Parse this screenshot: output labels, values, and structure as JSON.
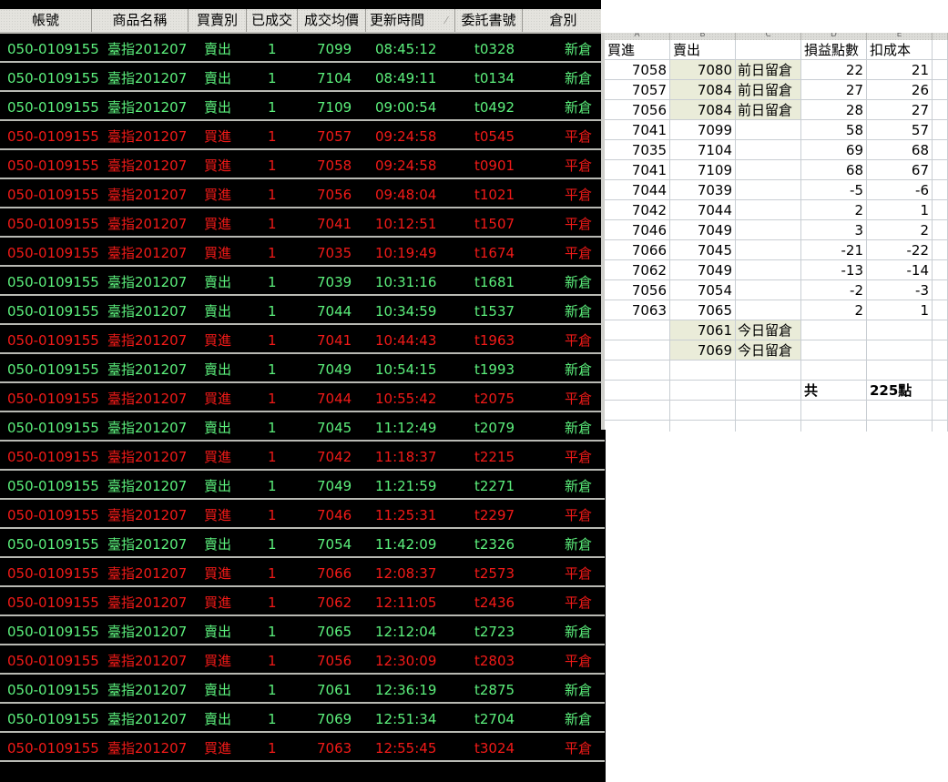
{
  "trade_table": {
    "columns": [
      "帳號",
      "商品名稱",
      "買賣別",
      "已成交",
      "成交均價",
      "更新時間",
      "委託書號",
      "倉別"
    ],
    "sorted_column_index": 5,
    "colors": {
      "sell_new": "#5cf07c",
      "buy_close": "#f21a18",
      "background": "#000000"
    },
    "rows": [
      {
        "account": "050-0109155",
        "product": "臺指201207",
        "side": "賣出",
        "filled": "1",
        "avg_price": "7099",
        "time": "08:45:12",
        "order_no": "t0328",
        "position": "新倉",
        "tone": "green"
      },
      {
        "account": "050-0109155",
        "product": "臺指201207",
        "side": "賣出",
        "filled": "1",
        "avg_price": "7104",
        "time": "08:49:11",
        "order_no": "t0134",
        "position": "新倉",
        "tone": "green"
      },
      {
        "account": "050-0109155",
        "product": "臺指201207",
        "side": "賣出",
        "filled": "1",
        "avg_price": "7109",
        "time": "09:00:54",
        "order_no": "t0492",
        "position": "新倉",
        "tone": "green"
      },
      {
        "account": "050-0109155",
        "product": "臺指201207",
        "side": "買進",
        "filled": "1",
        "avg_price": "7057",
        "time": "09:24:58",
        "order_no": "t0545",
        "position": "平倉",
        "tone": "red"
      },
      {
        "account": "050-0109155",
        "product": "臺指201207",
        "side": "買進",
        "filled": "1",
        "avg_price": "7058",
        "time": "09:24:58",
        "order_no": "t0901",
        "position": "平倉",
        "tone": "red"
      },
      {
        "account": "050-0109155",
        "product": "臺指201207",
        "side": "買進",
        "filled": "1",
        "avg_price": "7056",
        "time": "09:48:04",
        "order_no": "t1021",
        "position": "平倉",
        "tone": "red"
      },
      {
        "account": "050-0109155",
        "product": "臺指201207",
        "side": "買進",
        "filled": "1",
        "avg_price": "7041",
        "time": "10:12:51",
        "order_no": "t1507",
        "position": "平倉",
        "tone": "red"
      },
      {
        "account": "050-0109155",
        "product": "臺指201207",
        "side": "買進",
        "filled": "1",
        "avg_price": "7035",
        "time": "10:19:49",
        "order_no": "t1674",
        "position": "平倉",
        "tone": "red"
      },
      {
        "account": "050-0109155",
        "product": "臺指201207",
        "side": "賣出",
        "filled": "1",
        "avg_price": "7039",
        "time": "10:31:16",
        "order_no": "t1681",
        "position": "新倉",
        "tone": "green"
      },
      {
        "account": "050-0109155",
        "product": "臺指201207",
        "side": "賣出",
        "filled": "1",
        "avg_price": "7044",
        "time": "10:34:59",
        "order_no": "t1537",
        "position": "新倉",
        "tone": "green"
      },
      {
        "account": "050-0109155",
        "product": "臺指201207",
        "side": "買進",
        "filled": "1",
        "avg_price": "7041",
        "time": "10:44:43",
        "order_no": "t1963",
        "position": "平倉",
        "tone": "red"
      },
      {
        "account": "050-0109155",
        "product": "臺指201207",
        "side": "賣出",
        "filled": "1",
        "avg_price": "7049",
        "time": "10:54:15",
        "order_no": "t1993",
        "position": "新倉",
        "tone": "green"
      },
      {
        "account": "050-0109155",
        "product": "臺指201207",
        "side": "買進",
        "filled": "1",
        "avg_price": "7044",
        "time": "10:55:42",
        "order_no": "t2075",
        "position": "平倉",
        "tone": "red"
      },
      {
        "account": "050-0109155",
        "product": "臺指201207",
        "side": "賣出",
        "filled": "1",
        "avg_price": "7045",
        "time": "11:12:49",
        "order_no": "t2079",
        "position": "新倉",
        "tone": "green"
      },
      {
        "account": "050-0109155",
        "product": "臺指201207",
        "side": "買進",
        "filled": "1",
        "avg_price": "7042",
        "time": "11:18:37",
        "order_no": "t2215",
        "position": "平倉",
        "tone": "red"
      },
      {
        "account": "050-0109155",
        "product": "臺指201207",
        "side": "賣出",
        "filled": "1",
        "avg_price": "7049",
        "time": "11:21:59",
        "order_no": "t2271",
        "position": "新倉",
        "tone": "green"
      },
      {
        "account": "050-0109155",
        "product": "臺指201207",
        "side": "買進",
        "filled": "1",
        "avg_price": "7046",
        "time": "11:25:31",
        "order_no": "t2297",
        "position": "平倉",
        "tone": "red"
      },
      {
        "account": "050-0109155",
        "product": "臺指201207",
        "side": "賣出",
        "filled": "1",
        "avg_price": "7054",
        "time": "11:42:09",
        "order_no": "t2326",
        "position": "新倉",
        "tone": "green"
      },
      {
        "account": "050-0109155",
        "product": "臺指201207",
        "side": "買進",
        "filled": "1",
        "avg_price": "7066",
        "time": "12:08:37",
        "order_no": "t2573",
        "position": "平倉",
        "tone": "red"
      },
      {
        "account": "050-0109155",
        "product": "臺指201207",
        "side": "買進",
        "filled": "1",
        "avg_price": "7062",
        "time": "12:11:05",
        "order_no": "t2436",
        "position": "平倉",
        "tone": "red"
      },
      {
        "account": "050-0109155",
        "product": "臺指201207",
        "side": "賣出",
        "filled": "1",
        "avg_price": "7065",
        "time": "12:12:04",
        "order_no": "t2723",
        "position": "新倉",
        "tone": "green"
      },
      {
        "account": "050-0109155",
        "product": "臺指201207",
        "side": "買進",
        "filled": "1",
        "avg_price": "7056",
        "time": "12:30:09",
        "order_no": "t2803",
        "position": "平倉",
        "tone": "red"
      },
      {
        "account": "050-0109155",
        "product": "臺指201207",
        "side": "賣出",
        "filled": "1",
        "avg_price": "7061",
        "time": "12:36:19",
        "order_no": "t2875",
        "position": "新倉",
        "tone": "green"
      },
      {
        "account": "050-0109155",
        "product": "臺指201207",
        "side": "賣出",
        "filled": "1",
        "avg_price": "7069",
        "time": "12:51:34",
        "order_no": "t2704",
        "position": "新倉",
        "tone": "green"
      },
      {
        "account": "050-0109155",
        "product": "臺指201207",
        "side": "買進",
        "filled": "1",
        "avg_price": "7063",
        "time": "12:55:45",
        "order_no": "t3024",
        "position": "平倉",
        "tone": "red"
      }
    ]
  },
  "spreadsheet": {
    "column_letters": [
      "A",
      "B",
      "C",
      "D",
      "E",
      ""
    ],
    "header": {
      "buy": "買進",
      "sell": "賣出",
      "note": "",
      "pnl": "損益點數",
      "net": "扣成本"
    },
    "highlight_color": "#eef0df",
    "rows": [
      {
        "buy": "7058",
        "sell": "7080",
        "note": "前日留倉",
        "pnl": "22",
        "net": "21",
        "hl": true
      },
      {
        "buy": "7057",
        "sell": "7084",
        "note": "前日留倉",
        "pnl": "27",
        "net": "26",
        "hl": true
      },
      {
        "buy": "7056",
        "sell": "7084",
        "note": "前日留倉",
        "pnl": "28",
        "net": "27",
        "hl": true
      },
      {
        "buy": "7041",
        "sell": "7099",
        "note": "",
        "pnl": "58",
        "net": "57",
        "hl": false
      },
      {
        "buy": "7035",
        "sell": "7104",
        "note": "",
        "pnl": "69",
        "net": "68",
        "hl": false
      },
      {
        "buy": "7041",
        "sell": "7109",
        "note": "",
        "pnl": "68",
        "net": "67",
        "hl": false
      },
      {
        "buy": "7044",
        "sell": "7039",
        "note": "",
        "pnl": "-5",
        "net": "-6",
        "hl": false
      },
      {
        "buy": "7042",
        "sell": "7044",
        "note": "",
        "pnl": "2",
        "net": "1",
        "hl": false
      },
      {
        "buy": "7046",
        "sell": "7049",
        "note": "",
        "pnl": "3",
        "net": "2",
        "hl": false
      },
      {
        "buy": "7066",
        "sell": "7045",
        "note": "",
        "pnl": "-21",
        "net": "-22",
        "hl": false
      },
      {
        "buy": "7062",
        "sell": "7049",
        "note": "",
        "pnl": "-13",
        "net": "-14",
        "hl": false
      },
      {
        "buy": "7056",
        "sell": "7054",
        "note": "",
        "pnl": "-2",
        "net": "-3",
        "hl": false
      },
      {
        "buy": "7063",
        "sell": "7065",
        "note": "",
        "pnl": "2",
        "net": "1",
        "hl": false
      },
      {
        "buy": "",
        "sell": "7061",
        "note": "今日留倉",
        "pnl": "",
        "net": "",
        "hl": true
      },
      {
        "buy": "",
        "sell": "7069",
        "note": "今日留倉",
        "pnl": "",
        "net": "",
        "hl": true
      },
      {
        "buy": "",
        "sell": "",
        "note": "",
        "pnl": "",
        "net": "",
        "hl": false
      }
    ],
    "total": {
      "label": "共",
      "value": "225點"
    }
  }
}
